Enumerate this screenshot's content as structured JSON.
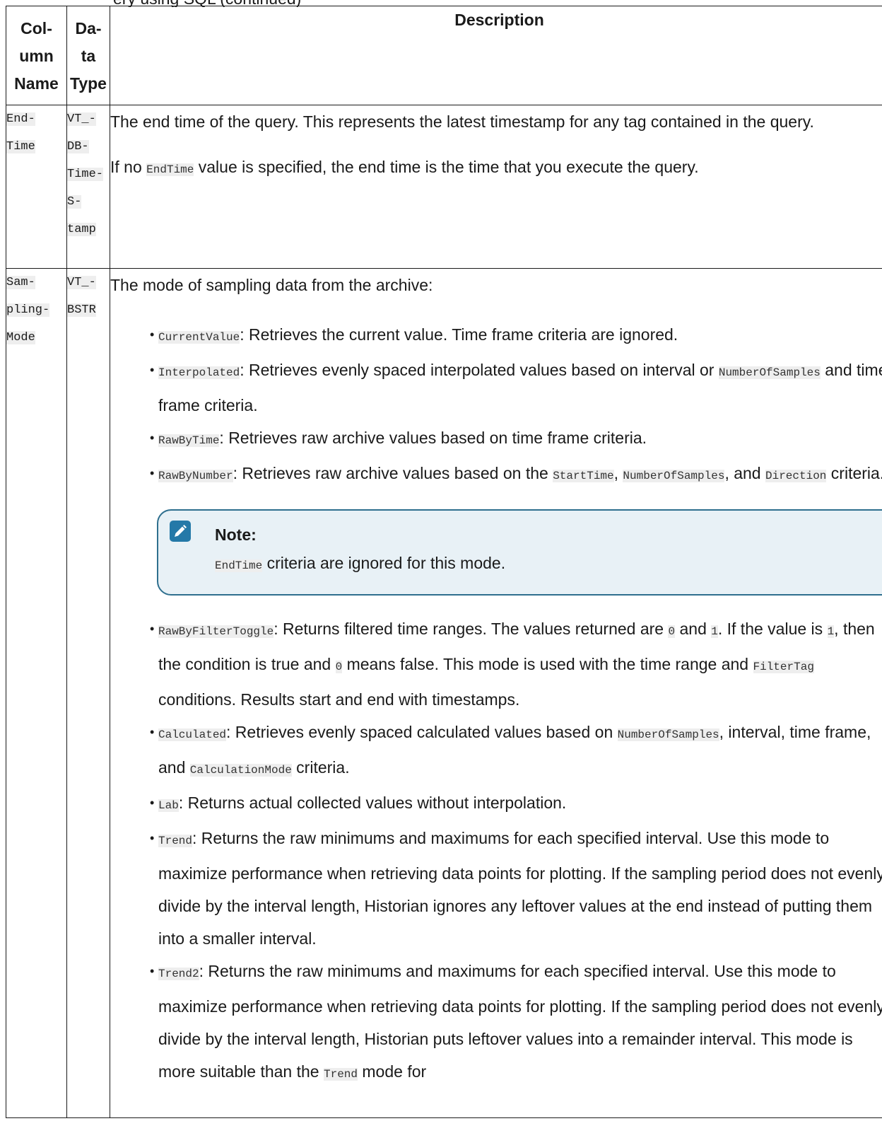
{
  "top_fragment": "ery using SQL (continued)",
  "headers": {
    "col1": [
      "Col-",
      "umn",
      "Name"
    ],
    "col2": [
      "Da-",
      "ta",
      "Type"
    ],
    "col3": "Description"
  },
  "rows": [
    {
      "name": [
        "End-",
        "Time"
      ],
      "type": [
        "VT_-",
        "DB-",
        "Time-",
        "S-",
        "tamp"
      ],
      "para1": "The end time of the query. This represents the latest timestamp for any tag contained in the query.",
      "para2_before": "If no ",
      "para2_code": "EndTime",
      "para2_after": " value is specified, the end time is the time that you execute the query."
    },
    {
      "name": [
        "Sam-",
        "pling-",
        "Mode"
      ],
      "type": [
        "VT_-",
        "BSTR"
      ],
      "intro": "The mode of sampling data from the archive:",
      "modes": {
        "current_code": "CurrentValue",
        "current_text": ": Retrieves the current value. Time frame criteria are ignored.",
        "interp_code": "Interpolated",
        "interp_text1": ": Retrieves evenly spaced interpolated values based on interval or ",
        "interp_code2": "NumberOfSamples",
        "interp_text2": " and time frame criteria.",
        "rawtime_code": "RawByTime",
        "rawtime_text": ": Retrieves raw archive values based on time frame criteria.",
        "rawnum_code": "RawByNumber",
        "rawnum_text1": ": Retrieves raw archive values based on the ",
        "rawnum_code2": "StartTime",
        "rawnum_sep": ", ",
        "rawnum_code3": "NumberOfSamples",
        "rawnum_text2": ", and ",
        "rawnum_code4": "Direction",
        "rawnum_text3": " criteria.",
        "note_title": "Note:",
        "note_code": "EndTime",
        "note_text": " criteria are ignored for this mode.",
        "filter_code": "RawByFilterToggle",
        "filter_text1": ": Returns filtered time ranges. The values returned are ",
        "filter_code0": "0",
        "filter_and": " and ",
        "filter_code1": "1",
        "filter_text2": ". If the value is ",
        "filter_code1b": "1",
        "filter_text3": ", then the condition is true and ",
        "filter_code0b": "0",
        "filter_text4": " means false. This mode is used with the time range and ",
        "filter_code_tag": "FilterTag",
        "filter_text5": " conditions. Results start and end with timestamps.",
        "calc_code": "Calculated",
        "calc_text1": ": Retrieves evenly spaced calculated values based on ",
        "calc_code2": "NumberOfSamples",
        "calc_text2": ", interval, time frame, and ",
        "calc_code3": "CalculationMode",
        "calc_text3": " criteria.",
        "lab_code": "Lab",
        "lab_text": ": Returns actual collected values without interpolation.",
        "trend_code": "Trend",
        "trend_text": ": Returns the raw minimums and maximums for each specified interval. Use this mode to maximize performance when retrieving data points for plotting. If the sampling period does not evenly divide by the interval length, Historian ignores any leftover values at the end instead of putting them into a smaller interval.",
        "trend2_code": "Trend2",
        "trend2_text1": ": Returns the raw minimums and maximums for each specified interval. Use this mode to maximize performance when retrieving data points for plotting. If the sampling period does not evenly divide by the interval length, Historian puts leftover values into a remainder interval. This mode is more suitable than the ",
        "trend2_code2": "Trend",
        "trend2_text2": " mode for"
      }
    }
  ],
  "icons": {
    "note": "pencil-icon"
  },
  "colors": {
    "note_border": "#2e6f8e",
    "note_bg": "#e8f1f6",
    "icon_bg": "#2479a8",
    "code_bg": "#eeeeee"
  }
}
